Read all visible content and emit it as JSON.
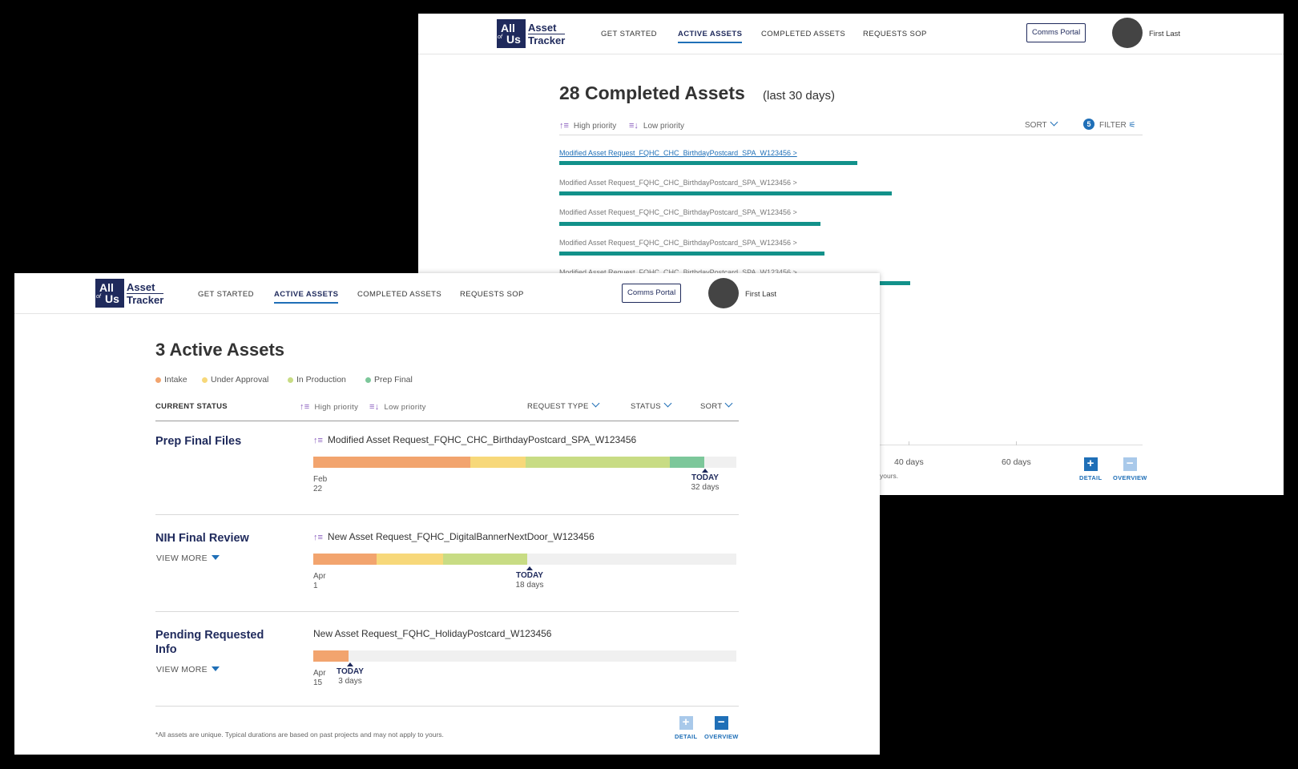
{
  "app": {
    "logo": {
      "all": "All",
      "of": "of",
      "us": "Us",
      "line1": "Asset",
      "line2": "Tracker"
    },
    "nav": [
      "GET STARTED",
      "ACTIVE ASSETS",
      "COMPLETED ASSETS",
      "REQUESTS SOP"
    ],
    "active_nav": "ACTIVE ASSETS",
    "comms_portal": "Comms Portal",
    "user_name": "First Last"
  },
  "completed_view": {
    "title": "28 Completed Assets",
    "subtitle": "(last 30 days)",
    "high_priority": "High priority",
    "low_priority": "Low priority",
    "sort": "SORT",
    "filter_count": "5",
    "filter": "FILTER",
    "rows": [
      {
        "label": "Modified Asset Request_FQHC_CHC_BirthdayPostcard_SPA_W123456 >"
      },
      {
        "label": "Modified Asset Request_FQHC_CHC_BirthdayPostcard_SPA_W123456 >"
      },
      {
        "label": "Modified Asset Request_FQHC_CHC_BirthdayPostcard_SPA_W123456 >"
      },
      {
        "label": "Modified Asset Request_FQHC_CHC_BirthdayPostcard_SPA_W123456 >"
      },
      {
        "label": "Modified Asset Request_FQHC_CHC_BirthdayPostcard_SPA_W123456 >"
      }
    ],
    "axis_labels": [
      "40 days",
      "60 days"
    ],
    "footnote_fragment": "yours.",
    "detail": "DETAIL",
    "overview": "OVERVIEW"
  },
  "active_view": {
    "title": "3 Active Assets",
    "legend": [
      {
        "label": "Intake",
        "color": "#f2a46e"
      },
      {
        "label": "Under Approval",
        "color": "#f7d87a"
      },
      {
        "label": "In Production",
        "color": "#c8dc84"
      },
      {
        "label": "Prep Final",
        "color": "#7cc79a"
      }
    ],
    "headers": {
      "current_status": "CURRENT STATUS",
      "high_priority": "High priority",
      "low_priority": "Low priority",
      "request_type": "REQUEST TYPE",
      "status": "STATUS",
      "sort": "SORT"
    },
    "assets": [
      {
        "stage": "Prep Final Files",
        "name": "Modified Asset Request_FQHC_CHC_BirthdayPostcard_SPA_W123456",
        "start_month": "Feb",
        "start_day": "22",
        "today": "TODAY",
        "days": "32 days"
      },
      {
        "stage": "NIH Final Review",
        "view_more": "VIEW MORE",
        "name": "New Asset Request_FQHC_DigitalBannerNextDoor_W123456",
        "start_month": "Apr",
        "start_day": "1",
        "today": "TODAY",
        "days": "18 days"
      },
      {
        "stage": "Pending Requested Info",
        "view_more": "VIEW MORE",
        "name": "New Asset Request_FQHC_HolidayPostcard_W123456",
        "start_month": "Apr",
        "start_day": "15",
        "today": "TODAY",
        "days": "3 days"
      }
    ],
    "footnote": "*All assets are unique. Typical durations are based on past projects and may not apply to yours.",
    "detail": "DETAIL",
    "overview": "OVERVIEW"
  },
  "colors": {
    "navy": "#1f2a5c",
    "accent": "#1f6fb7",
    "teal": "#12918a",
    "priority": "#8a5fbf"
  }
}
